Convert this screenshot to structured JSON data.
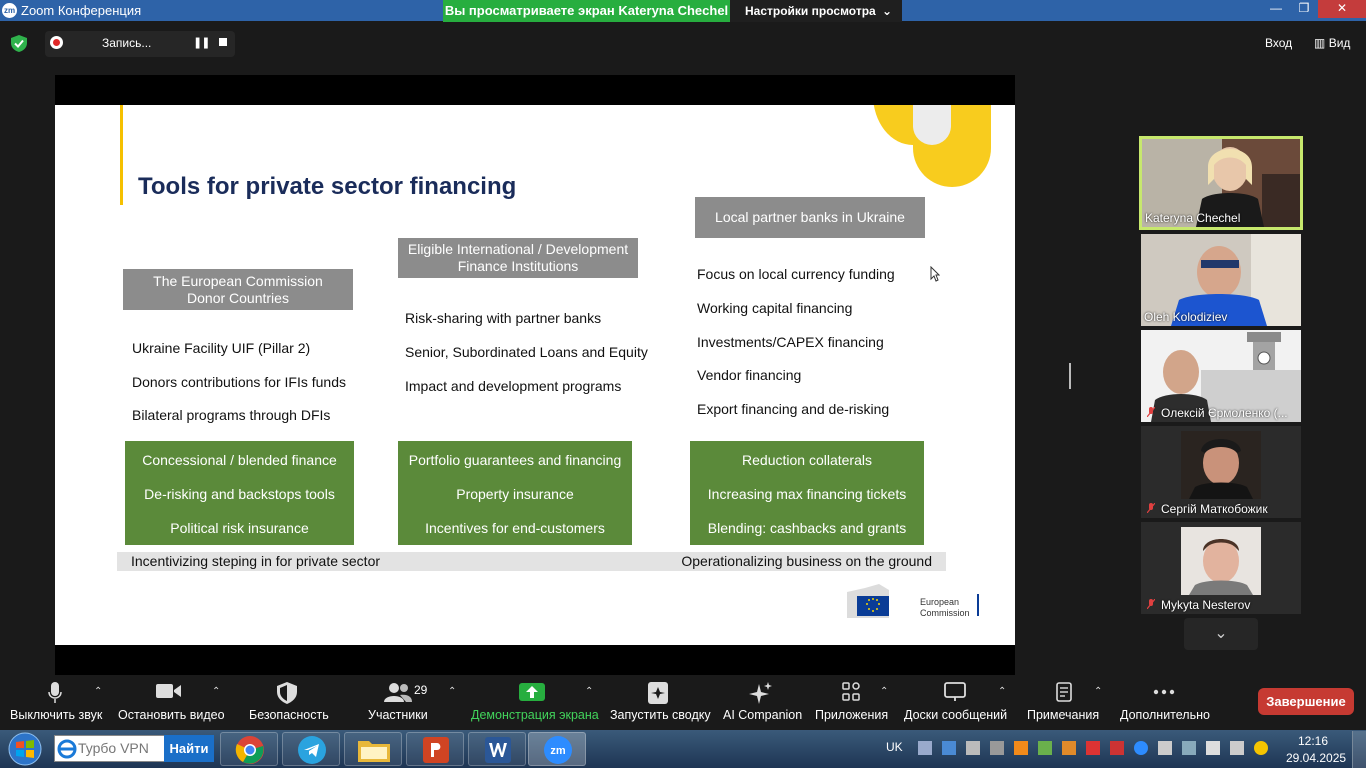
{
  "window": {
    "app_icon": "zm",
    "title": "Zoom Конференция",
    "share_banner": "Вы просматриваете экран Kateryna Chechel",
    "view_settings": "Настройки просмотра"
  },
  "recording": {
    "label": "Запись...",
    "pause_glyph": "❚❚"
  },
  "top_right": {
    "login": "Вход",
    "view": "Вид"
  },
  "slide": {
    "title": "Tools for private sector financing",
    "col1": {
      "header": "The European Commission\nDonor Countries",
      "items": [
        "Ukraine Facility UIF (Pillar 2)",
        "Donors contributions for IFIs funds",
        "Bilateral programs through DFIs"
      ],
      "green": [
        "Concessional / blended finance",
        "De-risking and backstops tools",
        "Political risk insurance"
      ]
    },
    "col2": {
      "header": "Eligible International / Development\nFinance Institutions",
      "items": [
        "Risk-sharing with partner banks",
        "Senior, Subordinated Loans and Equity",
        "Impact and development programs"
      ],
      "green": [
        "Portfolio guarantees and financing",
        "Property insurance",
        "Incentives for end-customers"
      ]
    },
    "col3": {
      "header": "Local partner banks in Ukraine",
      "items": [
        "Focus on local currency funding",
        "Working capital financing",
        "Investments/CAPEX financing",
        "Vendor financing",
        "Export financing and de-risking"
      ],
      "green": [
        "Reduction collaterals",
        "Increasing max financing tickets",
        "Blending: cashbacks and grants"
      ]
    },
    "bottom_left": "Incentivizing steping in for private sector",
    "bottom_right": "Operationalizing business on the ground",
    "logo_text_1": "European",
    "logo_text_2": "Commission"
  },
  "participants": [
    {
      "name": "Kateryna Chechel",
      "muted": false,
      "active": true
    },
    {
      "name": "Oleh Kolodiziev",
      "muted": false,
      "active": false
    },
    {
      "name": "Олексій Єрмоленко (...",
      "muted": true,
      "active": false
    },
    {
      "name": "Сергій Маткобожик",
      "muted": true,
      "active": false
    },
    {
      "name": "Mykyta Nesterov",
      "muted": true,
      "active": false
    }
  ],
  "toolbar": {
    "mute": "Выключить звук",
    "stop_video": "Остановить видео",
    "security": "Безопасность",
    "participants": "Участники",
    "participants_count": "29",
    "share": "Демонстрация экрана",
    "summary": "Запустить сводку",
    "ai": "AI Companion",
    "apps": "Приложения",
    "whiteboards": "Доски сообщений",
    "notes": "Примечания",
    "more": "Дополнительно",
    "end": "Завершение"
  },
  "taskbar": {
    "vpn_placeholder": "Турбо VPN",
    "vpn_go": "Найти",
    "lang": "UK",
    "time": "12:16",
    "date": "29.04.2025"
  },
  "colors": {
    "accent_green": "#27ae3f",
    "slide_green": "#5b8a3a",
    "end_red": "#c63a32",
    "title_navy": "#1a2c5a"
  }
}
